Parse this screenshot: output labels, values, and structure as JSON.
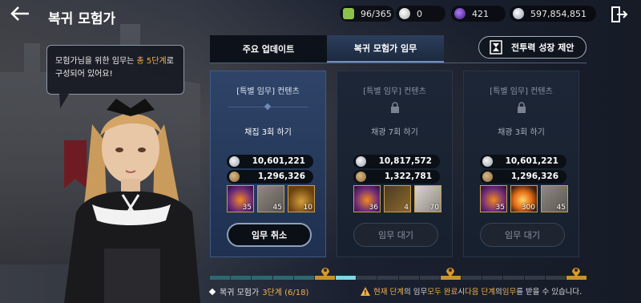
{
  "header": {
    "title": "복귀 모험가",
    "resources": [
      {
        "icon": "energy-icon",
        "value": "96/365",
        "color": "#8bc34a"
      },
      {
        "icon": "pearl-icon",
        "value": "0",
        "color": "#d9d6d0"
      },
      {
        "icon": "crystal-icon",
        "value": "421",
        "color": "#7a3fbf"
      },
      {
        "icon": "silver-icon",
        "value": "597,854,851",
        "color": "#cfd6df"
      }
    ]
  },
  "bubble": {
    "line1_pre": "모험가님을 위한 임무는 ",
    "line1_hl": "총 5단계",
    "line1_post": "로",
    "line2": "구성되어 있어요!"
  },
  "tabs": [
    {
      "label": "주요 업데이트"
    },
    {
      "label": "복귀 모험가 임무"
    }
  ],
  "proposal_button": {
    "label": "전투력 성장 제안"
  },
  "cards": [
    {
      "title": "[특별 임무] 컨텐츠",
      "task": "채집 3회 하기",
      "silver": "10,601,221",
      "exp": "1,296,326",
      "items": [
        {
          "icon": "mystery-box-icon",
          "qty": "35"
        },
        {
          "icon": "scroll-icon",
          "qty": "45"
        },
        {
          "icon": "treasure-chest-icon",
          "qty": "10"
        }
      ],
      "action": "임무 취소"
    },
    {
      "title": "[특별 임무] 컨텐츠",
      "task": "채광 7회 하기",
      "silver": "10,817,572",
      "exp": "1,322,781",
      "items": [
        {
          "icon": "mystery-box-icon",
          "qty": "36"
        },
        {
          "icon": "gift-boxes-icon",
          "qty": "4"
        },
        {
          "icon": "paper-icon",
          "qty": "70"
        }
      ],
      "action": "임무 대기"
    },
    {
      "title": "[특별 임무] 컨텐츠",
      "task": "채광 3회 하기",
      "silver": "10,601,221",
      "exp": "1,296,326",
      "items": [
        {
          "icon": "mystery-box-icon",
          "qty": "35"
        },
        {
          "icon": "fire-stone-icon",
          "qty": "300"
        },
        {
          "icon": "scroll-icon",
          "qty": "45"
        }
      ],
      "action": "임무 대기"
    }
  ],
  "progress": {
    "label": "복귀 모험가",
    "stage": "3단계 (6/18)",
    "current": 6,
    "total": 18
  },
  "notice": {
    "p1": "현재 단계",
    "p2": "의 임무 ",
    "p3": "모두 완료",
    "p4": " 시 ",
    "p5": "다음 단계",
    "p6": "의 ",
    "p7": "임무",
    "p8": "를 받을 수 있습니다."
  }
}
